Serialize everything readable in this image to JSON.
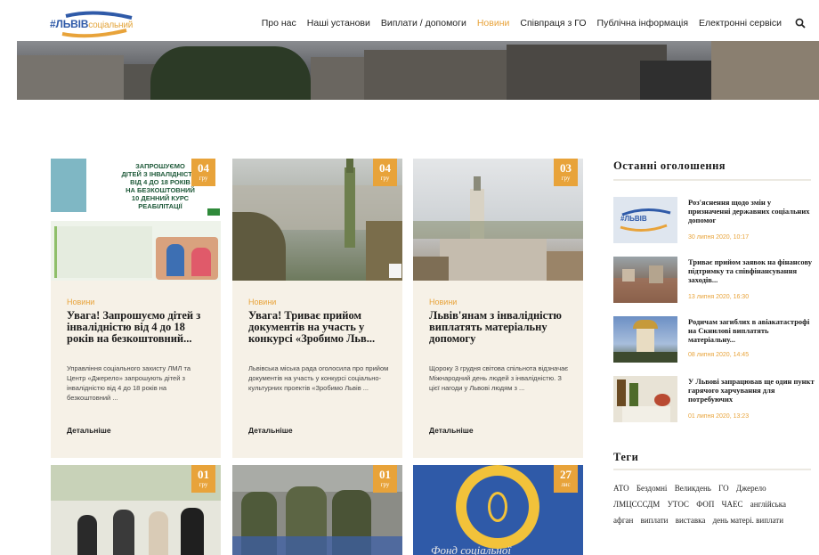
{
  "header": {
    "logo_main": "#ЛЬВІВ",
    "logo_sub": "соціальний",
    "nav": [
      {
        "label": "Про нас",
        "active": false
      },
      {
        "label": "Наші установи",
        "active": false
      },
      {
        "label": "Виплати / допомоги",
        "active": false
      },
      {
        "label": "Новини",
        "active": true
      },
      {
        "label": "Співпраця з ГО",
        "active": false
      },
      {
        "label": "Публічна інформація",
        "active": false
      },
      {
        "label": "Електронні сервіси",
        "active": false
      }
    ],
    "search_icon": "search-icon"
  },
  "cards": [
    {
      "day": "04",
      "month": "гру",
      "image_text": [
        "ЗАПРОШУЄМО",
        "ДІТЕЙ З ІНВАЛІДНІСТЮ",
        "ВІД 4 ДО 18 РОКІВ",
        "НА БЕЗКОШТОВНИЙ",
        "10 ДЕННИЙ КУРС РЕАБІЛІТАЦІЇ"
      ],
      "category": "Новини",
      "title": "Увага! Запрошуємо дітей з інвалідністю від 4 до 18 років на безкоштовний...",
      "text": "Управління соціального захисту ЛМЛ та Центр «Джерело» запрошують дітей з інвалідністю від 4 до 18 років на безкоштовний ...",
      "more": "Детальніше"
    },
    {
      "day": "04",
      "month": "гру",
      "category": "Новини",
      "title": "Увага! Триває прийом документів на участь у конкурсі «Зробимо Льв...",
      "text": "Львівська міська рада оголосила про прийом документів на участь у конкурсі соціально-культурних проектів «Зробимо Львів ...",
      "more": "Детальніше"
    },
    {
      "day": "03",
      "month": "гру",
      "category": "Новини",
      "title": "Львів'янам з інвалідністю виплатять матеріальну допомогу",
      "text": "Щороку 3 грудня світова спільнота відзначає Міжнародний день людей з інвалідністю. З цієї нагоди у Львові людям з ...",
      "more": "Детальніше"
    },
    {
      "day": "01",
      "month": "гру"
    },
    {
      "day": "01",
      "month": "гру"
    },
    {
      "day": "27",
      "month": "лис",
      "image_text": "Фонд соціальної"
    }
  ],
  "sidebar": {
    "announcements_title": "Останні оголошення",
    "announcements": [
      {
        "title": "Роз'яснення щодо змін у призначенні державних соціальних допомог",
        "date": "30 липня 2020, 10:17"
      },
      {
        "title": "Триває прийом заявок на фінансову підтримку та співфінансування заходів...",
        "date": "13 липня 2020, 16:30"
      },
      {
        "title": "Родичам загиблих в авіакатастрофі на Скнилові виплатять матеріальну...",
        "date": "08 липня 2020, 14:45"
      },
      {
        "title": "У Львові запрацював ще один пункт гарячого харчування для потребуючих",
        "date": "01 липня 2020, 13:23"
      }
    ],
    "tags_title": "Теги",
    "tags": [
      "АТО",
      "Бездомні",
      "Великдень",
      "ГО",
      "Джерело",
      "ЛМЦСССДМ",
      "УТОС",
      "ФОП",
      "ЧАЕС",
      "англійська",
      "афган",
      "виплати",
      "виставка",
      "день матері. виплати"
    ]
  }
}
